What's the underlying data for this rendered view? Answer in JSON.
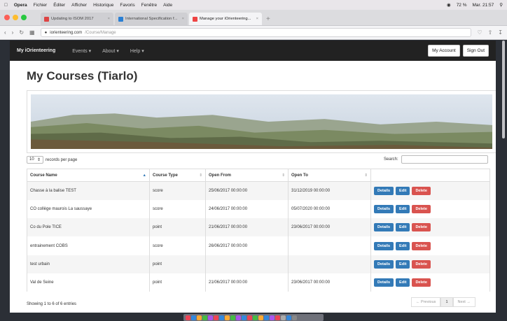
{
  "os_menubar": {
    "app": "Opera",
    "items": [
      "Fichier",
      "Éditer",
      "Afficher",
      "Historique",
      "Favoris",
      "Fenêtre",
      "Aide"
    ],
    "battery": "72 %",
    "clock": "Mar. 21:57"
  },
  "browser": {
    "tabs": [
      {
        "title": "Updating to ISOM 2017",
        "fav_color": "#d44"
      },
      {
        "title": "International Specification f...",
        "fav_color": "#2a7fd4"
      },
      {
        "title": "Manage your iOrienteering...",
        "fav_color": "#e44"
      }
    ],
    "new_tab": "+",
    "url_host": "iorienteering.com",
    "url_path": "/Course/Manage"
  },
  "navbar": {
    "brand": "My iOrienteering",
    "items": [
      "Events ▾",
      "About ▾",
      "Help ▾"
    ],
    "my_account": "My Account",
    "sign_out": "Sign Out"
  },
  "page": {
    "title": "My Courses (Tiarlo)",
    "per_page_value": "10",
    "per_page_label": "records per page",
    "search_label": "Search:",
    "columns": [
      "Course Name",
      "Course Type",
      "Open From",
      "Open To",
      ""
    ],
    "rows": [
      {
        "name": "Chasse à la balise TEST",
        "type": "score",
        "from": "25/06/2017 00:00:00",
        "to": "31/12/2019 00:00:00"
      },
      {
        "name": "CO collège maurois La saussaye",
        "type": "score",
        "from": "24/06/2017 00:00:00",
        "to": "05/07/2020 00:00:00"
      },
      {
        "name": "Co du Pole TICE",
        "type": "point",
        "from": "21/06/2017 00:00:00",
        "to": "23/06/2017 00:00:00"
      },
      {
        "name": "entrainement COBS",
        "type": "score",
        "from": "26/06/2017 00:00:00",
        "to": ""
      },
      {
        "name": "test urbain",
        "type": "point",
        "from": "",
        "to": ""
      },
      {
        "name": "Val de Seine",
        "type": "point",
        "from": "21/06/2017 00:00:00",
        "to": "23/06/2017 00:00:00"
      }
    ],
    "btn_details": "Details",
    "btn_edit": "Edit",
    "btn_delete": "Delete",
    "showing": "Showing 1 to 6 of 6 entries",
    "pager": {
      "prev": "← Previous",
      "current": "1",
      "next": "Next →"
    }
  },
  "colors": {
    "primary": "#337ab7",
    "danger": "#d9534f",
    "navbar": "#222222"
  }
}
